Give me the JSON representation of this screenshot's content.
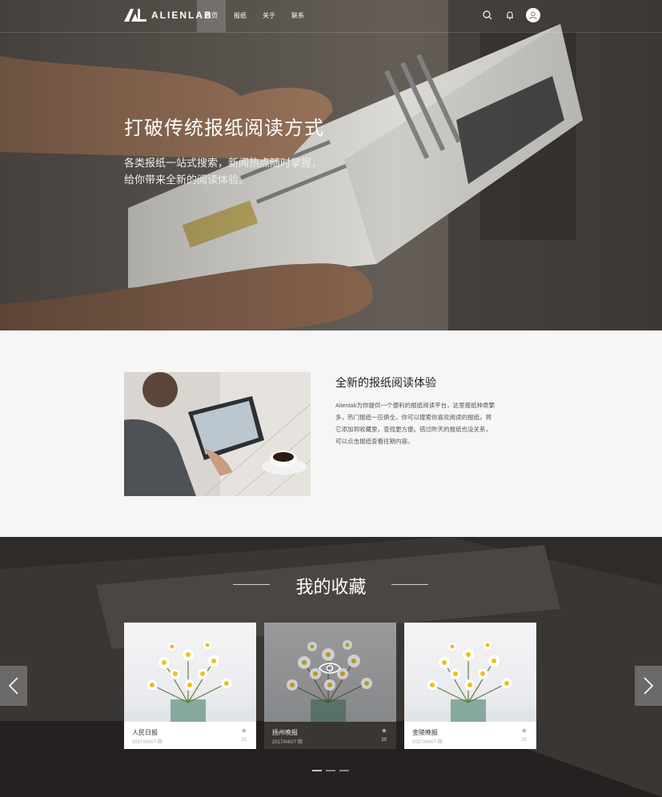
{
  "brand": {
    "logo_text": "ALIENLAB"
  },
  "nav": {
    "items": [
      {
        "label": "首页",
        "active": true
      },
      {
        "label": "报纸",
        "active": false
      },
      {
        "label": "关于",
        "active": false
      },
      {
        "label": "联系",
        "active": false
      }
    ],
    "icons": [
      "search-icon",
      "bell-icon",
      "user-avatar-icon"
    ]
  },
  "hero": {
    "title": "打破传统报纸阅读方式",
    "subtitle_line1": "各类报纸一站式搜索，新闻热点随时掌握，",
    "subtitle_line2": "给你带来全新的阅读体验。"
  },
  "intro": {
    "title": "全新的报纸阅读体验",
    "text": "Alienlab为你提供一个便利的报纸阅读平台，这里报纸种类繁多，热门报纸一应俱全。你可以搜索你喜欢阅读的报纸，将它添加到收藏里，查找更方便。错过昨天的报纸也没关系，可以点击报纸查看往期内容。"
  },
  "favorites": {
    "title": "我的收藏",
    "cards": [
      {
        "name": "人民日报",
        "date": "2017/04/07 期",
        "count": "20",
        "hovered": false
      },
      {
        "name": "扬州晚报",
        "date": "2017/04/07 期",
        "count": "20",
        "hovered": true
      },
      {
        "name": "金陵晚报",
        "date": "2017/04/07 期",
        "count": "20",
        "hovered": false
      }
    ],
    "pagination_dots": 3,
    "active_dot": 0
  },
  "colors": {
    "accent_star": "#c8a58a",
    "favorites_bg": "#2e2b29",
    "intro_bg": "#f6f6f6"
  }
}
